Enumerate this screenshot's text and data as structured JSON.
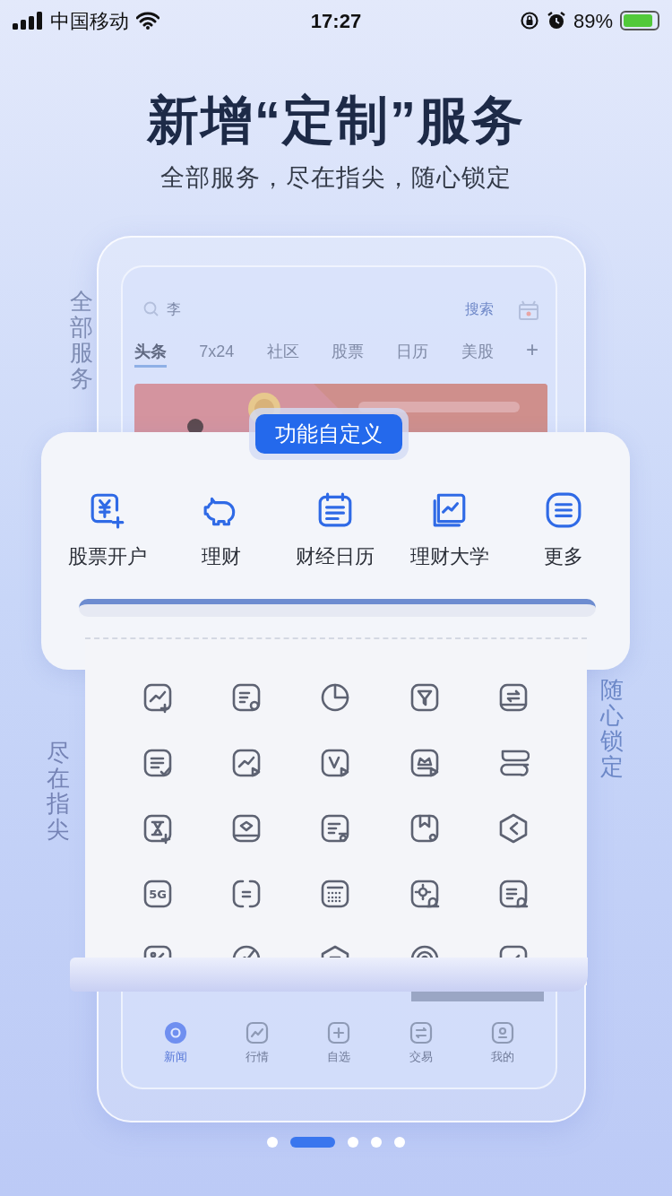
{
  "status_bar": {
    "carrier": "中国移动",
    "time": "17:27",
    "battery": "89%"
  },
  "headline": "新增“定制”服务",
  "subtitle": "全部服务，尽在指尖，随心锁定",
  "side_captions": [
    {
      "kind": "lefttop",
      "text": "全部服务"
    },
    {
      "kind": "leftbottom",
      "text": "尽在指尖"
    },
    {
      "kind": "right",
      "text": "随心锁定"
    }
  ],
  "mock_app": {
    "search": {
      "value": "李",
      "button": "搜索"
    },
    "tabs": [
      {
        "label": "头条",
        "selected": true
      },
      {
        "label": "7x24",
        "selected": false
      },
      {
        "label": "社区",
        "selected": false
      },
      {
        "label": "股票",
        "selected": false
      },
      {
        "label": "日历",
        "selected": false
      },
      {
        "label": "美股",
        "selected": false
      }
    ],
    "add_tab": "+",
    "bottom_nav": [
      {
        "label": "新闻",
        "kind": "news",
        "selected": true
      },
      {
        "label": "行情",
        "kind": "market",
        "selected": false
      },
      {
        "label": "自选",
        "kind": "watch",
        "selected": false
      },
      {
        "label": "交易",
        "kind": "trade",
        "selected": false
      },
      {
        "label": "我的",
        "kind": "me",
        "selected": false
      }
    ]
  },
  "feature_card": {
    "badge": "功能自定义",
    "shortcuts": [
      {
        "label": "股票开户",
        "kind": "yuan"
      },
      {
        "label": "理财",
        "kind": "piggy"
      },
      {
        "label": "财经日历",
        "kind": "calendar"
      },
      {
        "label": "理财大学",
        "kind": "book"
      },
      {
        "label": "更多",
        "kind": "more"
      }
    ]
  },
  "icon_grid": [
    {
      "kind": "chart"
    },
    {
      "kind": "note"
    },
    {
      "kind": "pie"
    },
    {
      "kind": "filter"
    },
    {
      "kind": "swap"
    },
    {
      "kind": "check"
    },
    {
      "kind": "trend"
    },
    {
      "kind": "video"
    },
    {
      "kind": "crown"
    },
    {
      "kind": "stack"
    },
    {
      "kind": "hourglass"
    },
    {
      "kind": "diamond"
    },
    {
      "kind": "coin"
    },
    {
      "kind": "bookmark"
    },
    {
      "kind": "hexagon"
    },
    {
      "kind": "label",
      "text": "5G"
    },
    {
      "kind": "refresh"
    },
    {
      "kind": "calendar"
    },
    {
      "kind": "gear"
    },
    {
      "kind": "bell"
    },
    {
      "kind": "percent"
    },
    {
      "kind": "gauge"
    },
    {
      "kind": "house"
    },
    {
      "kind": "target"
    },
    {
      "kind": "tick"
    }
  ],
  "pagination": [
    {
      "selected": false
    },
    {
      "selected": true
    },
    {
      "selected": false
    },
    {
      "selected": false
    },
    {
      "selected": false
    }
  ]
}
